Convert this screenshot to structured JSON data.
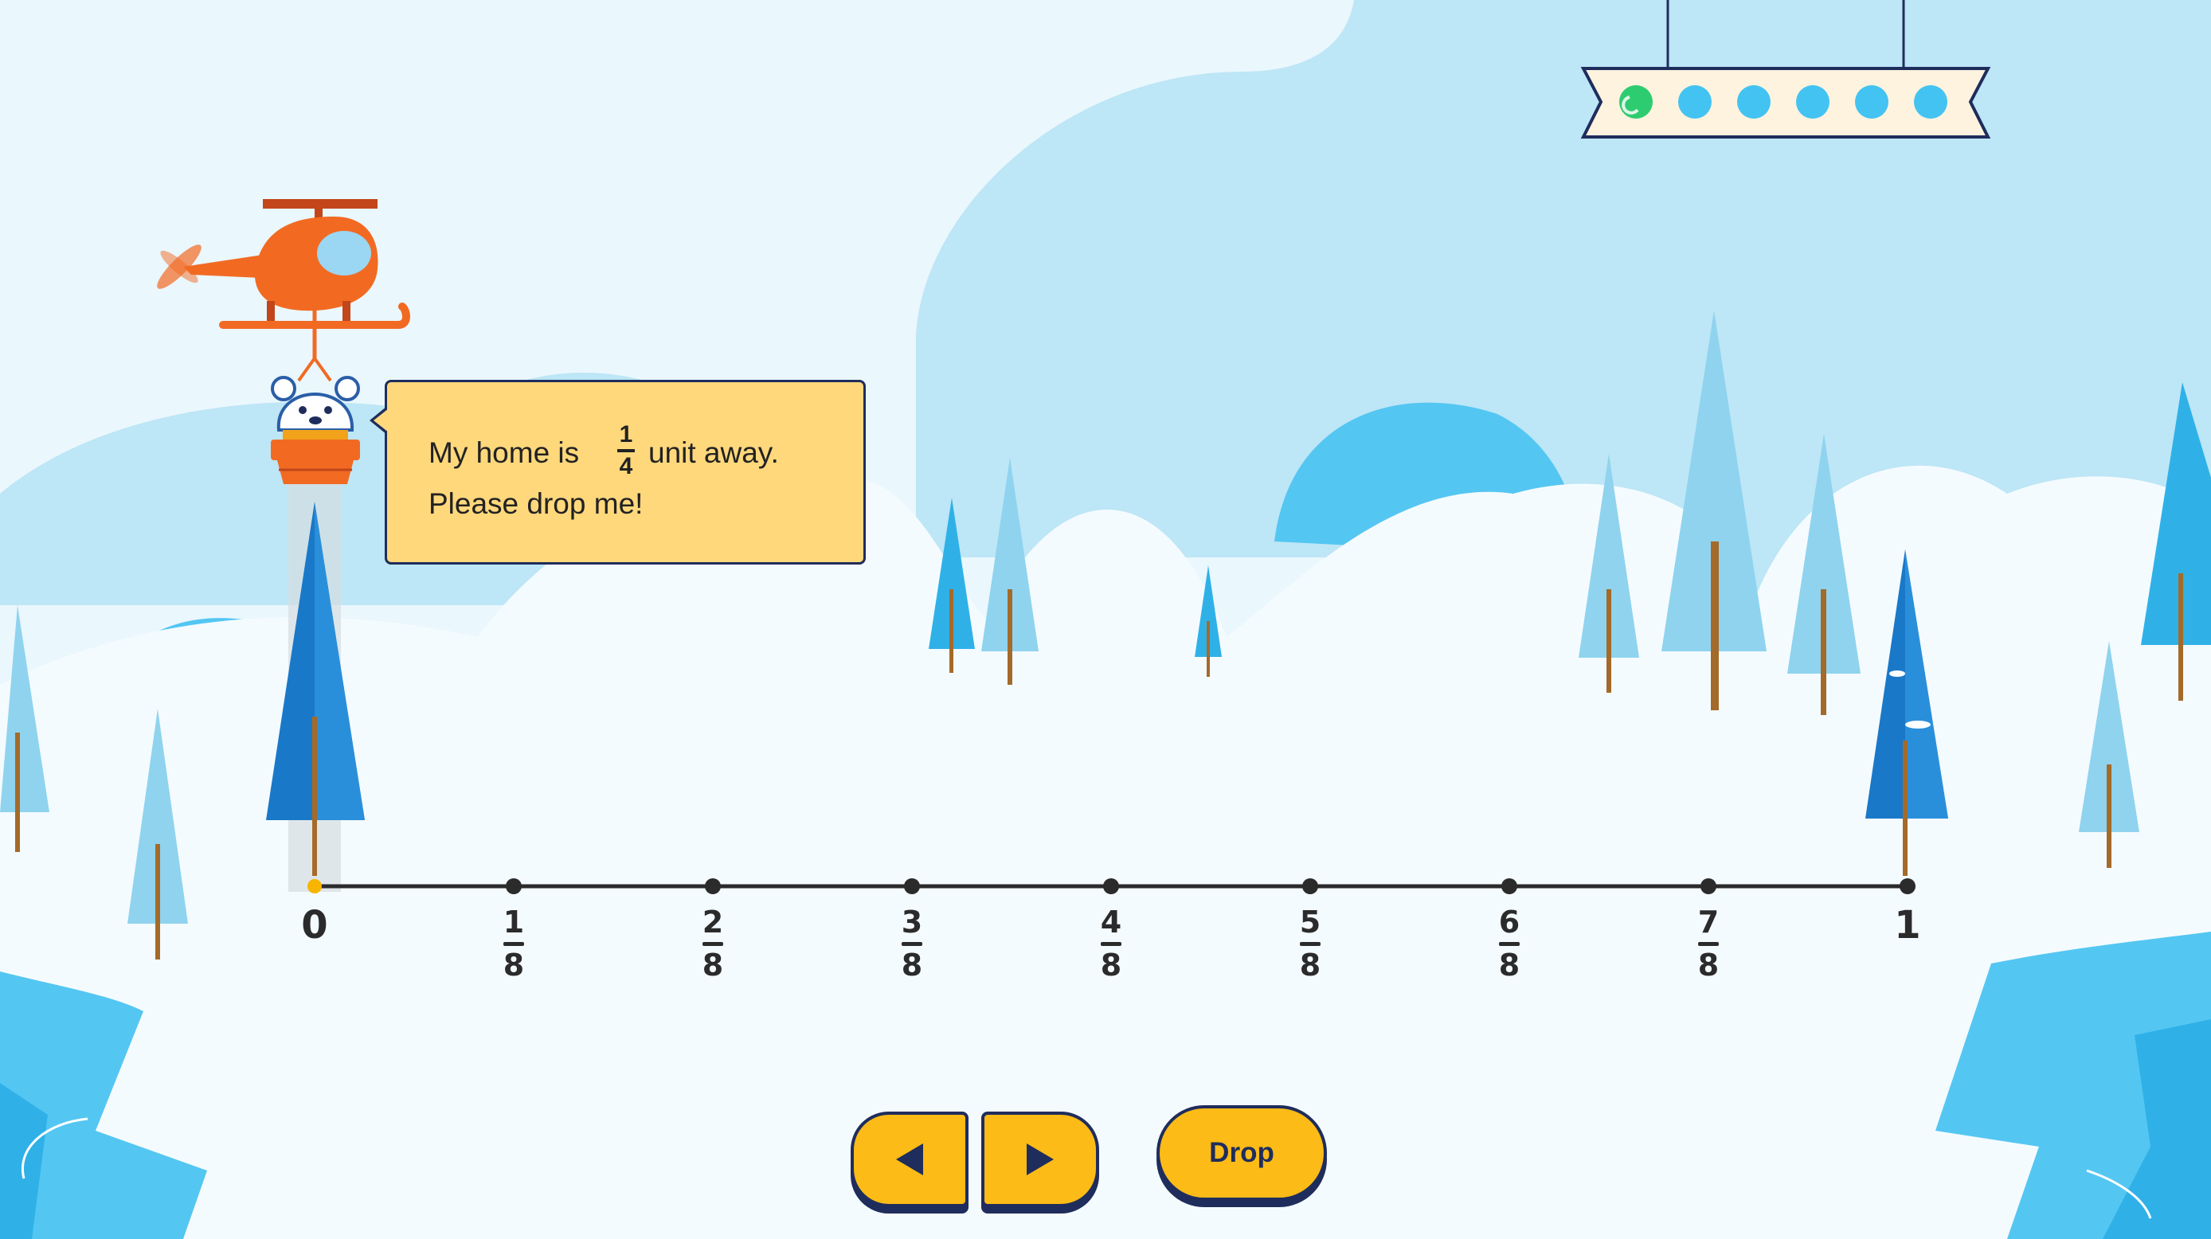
{
  "speech_bubble": {
    "text_before": "My home is",
    "fraction_numerator": "1",
    "fraction_denominator": "4",
    "text_after": "unit away.",
    "line2": "Please drop me!"
  },
  "number_line": {
    "start_label": "0",
    "end_label": "1",
    "denominator": "8",
    "numerators": [
      "1",
      "2",
      "3",
      "4",
      "5",
      "6",
      "7"
    ],
    "current_position": "0"
  },
  "progress": {
    "total_steps": 6,
    "completed_steps": 1,
    "completed_color": "#2ecc71",
    "pending_color": "#43c3f2"
  },
  "controls": {
    "left_icon": "left-arrow-icon",
    "right_icon": "right-arrow-icon",
    "drop_label": "Drop"
  },
  "colors": {
    "accent_yellow": "#fdbb17",
    "outline_navy": "#1f2d5c",
    "helicopter_orange": "#f26a22",
    "bubble_fill": "#ffd87c"
  }
}
